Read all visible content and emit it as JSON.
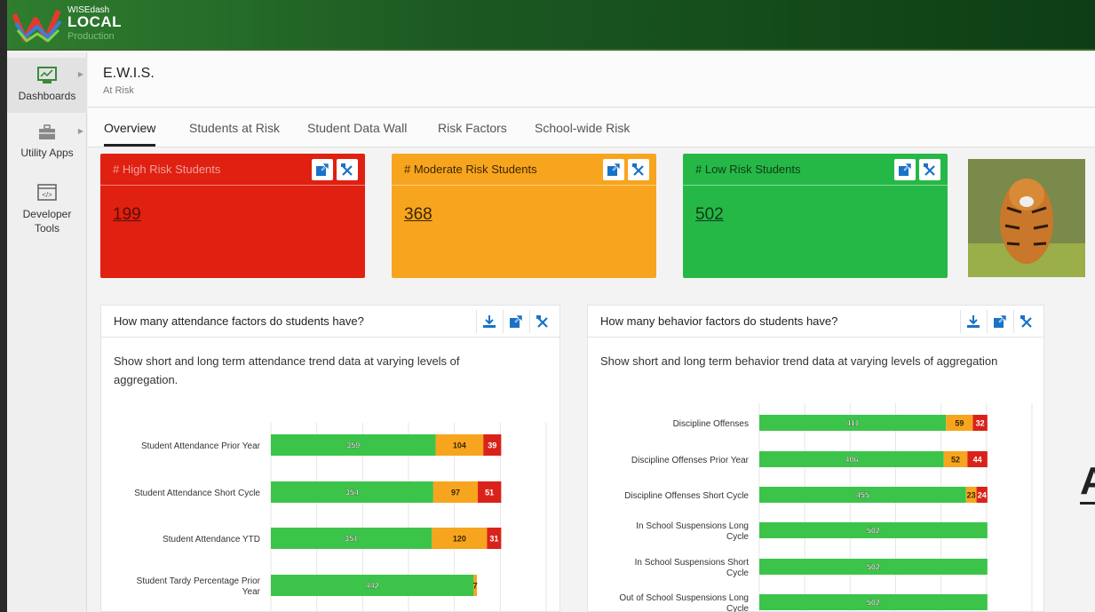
{
  "app": {
    "logo_line1": "WISEdash",
    "logo_line2": "LOCAL",
    "logo_line3": "Production"
  },
  "sidebar": {
    "items": [
      {
        "label": "Dashboards",
        "icon": "chart-monitor-icon"
      },
      {
        "label": "Utility Apps",
        "icon": "toolbox-icon"
      },
      {
        "label": "Developer Tools",
        "icon": "code-window-icon"
      }
    ]
  },
  "header": {
    "title": "E.W.I.S.",
    "subtitle": "At Risk"
  },
  "tabs": [
    {
      "label": "Overview",
      "active": true
    },
    {
      "label": "Students at Risk"
    },
    {
      "label": "Student Data Wall"
    },
    {
      "label": "Risk Factors"
    },
    {
      "label": "School-wide Risk"
    }
  ],
  "kpis": {
    "high": {
      "label": "# High Risk Students",
      "value": "199",
      "color": "#e02010"
    },
    "moderate": {
      "label": "# Moderate Risk Students",
      "value": "368",
      "color": "#f7a51e"
    },
    "low": {
      "label": "# Low Risk Students",
      "value": "502",
      "color": "#26b847"
    }
  },
  "panels": {
    "attendance": {
      "title": "How many attendance factors do students have?",
      "description_line1": "Show short and long term attendance trend data at varying levels of",
      "description_line2": "aggregation."
    },
    "behavior": {
      "title": "How many behavior factors do students have?",
      "description_line1": "Show short and long term behavior trend data at varying levels of aggregation"
    }
  },
  "colors": {
    "low": "#3cc44a",
    "moderate": "#f7a51e",
    "high": "#d9231a"
  },
  "trailing_glyph": "A",
  "chart_data": [
    {
      "type": "bar",
      "orientation": "horizontal",
      "stacked": true,
      "categories": [
        "Student Attendance Prior Year",
        "Student Attendance Short Cycle",
        "Student Attendance YTD",
        "Student Tardy Percentage Prior Year"
      ],
      "series": [
        {
          "values": [
            359,
            354,
            351,
            442
          ],
          "color": "#3cc44a"
        },
        {
          "values": [
            104,
            97,
            120,
            7
          ],
          "color": "#f7a51e"
        },
        {
          "values": [
            39,
            51,
            31,
            0
          ],
          "color": "#d9231a"
        }
      ],
      "xlim": [
        0,
        600
      ],
      "grid": true
    },
    {
      "type": "bar",
      "orientation": "horizontal",
      "stacked": true,
      "categories": [
        "Discipline Offenses",
        "Discipline Offenses Prior Year",
        "Discipline Offenses Short Cycle",
        "In School Suspensions Long Cycle",
        "In School Suspensions Short Cycle",
        "Out of School Suspensions Long Cycle"
      ],
      "series": [
        {
          "values": [
            411,
            406,
            455,
            502,
            502,
            502
          ],
          "color": "#3cc44a"
        },
        {
          "values": [
            59,
            52,
            23,
            0,
            0,
            0
          ],
          "color": "#f7a51e"
        },
        {
          "values": [
            32,
            44,
            24,
            0,
            0,
            0
          ],
          "color": "#d9231a"
        }
      ],
      "xlim": [
        0,
        600
      ],
      "grid": true
    }
  ]
}
